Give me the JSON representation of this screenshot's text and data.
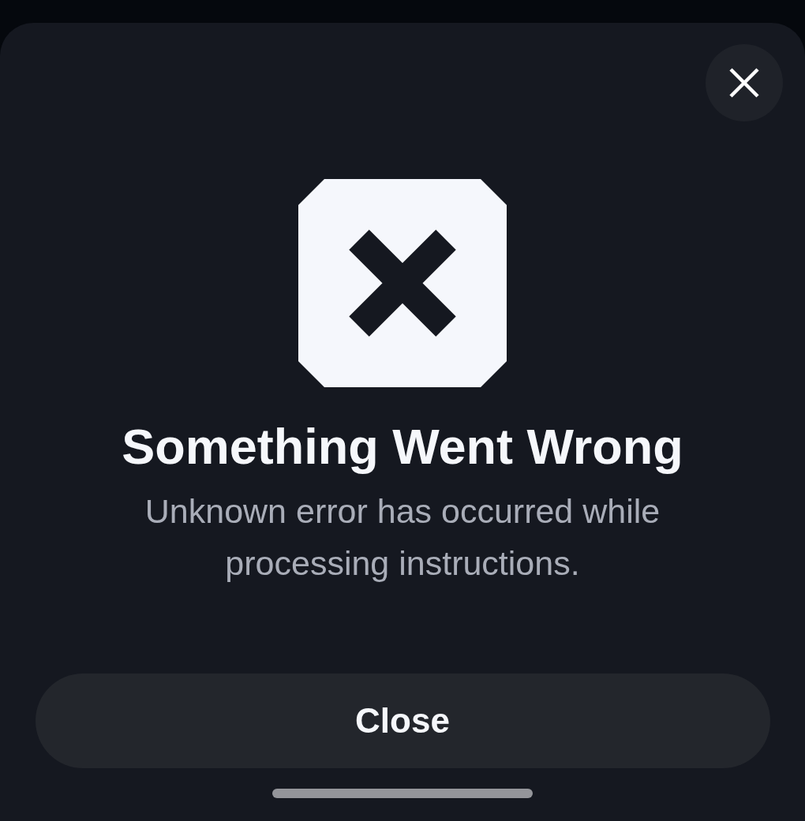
{
  "dialog": {
    "title": "Something Went Wrong",
    "message": "Unknown error has occurred while processing instructions.",
    "buttons": [
      {
        "label": "Close"
      }
    ]
  }
}
